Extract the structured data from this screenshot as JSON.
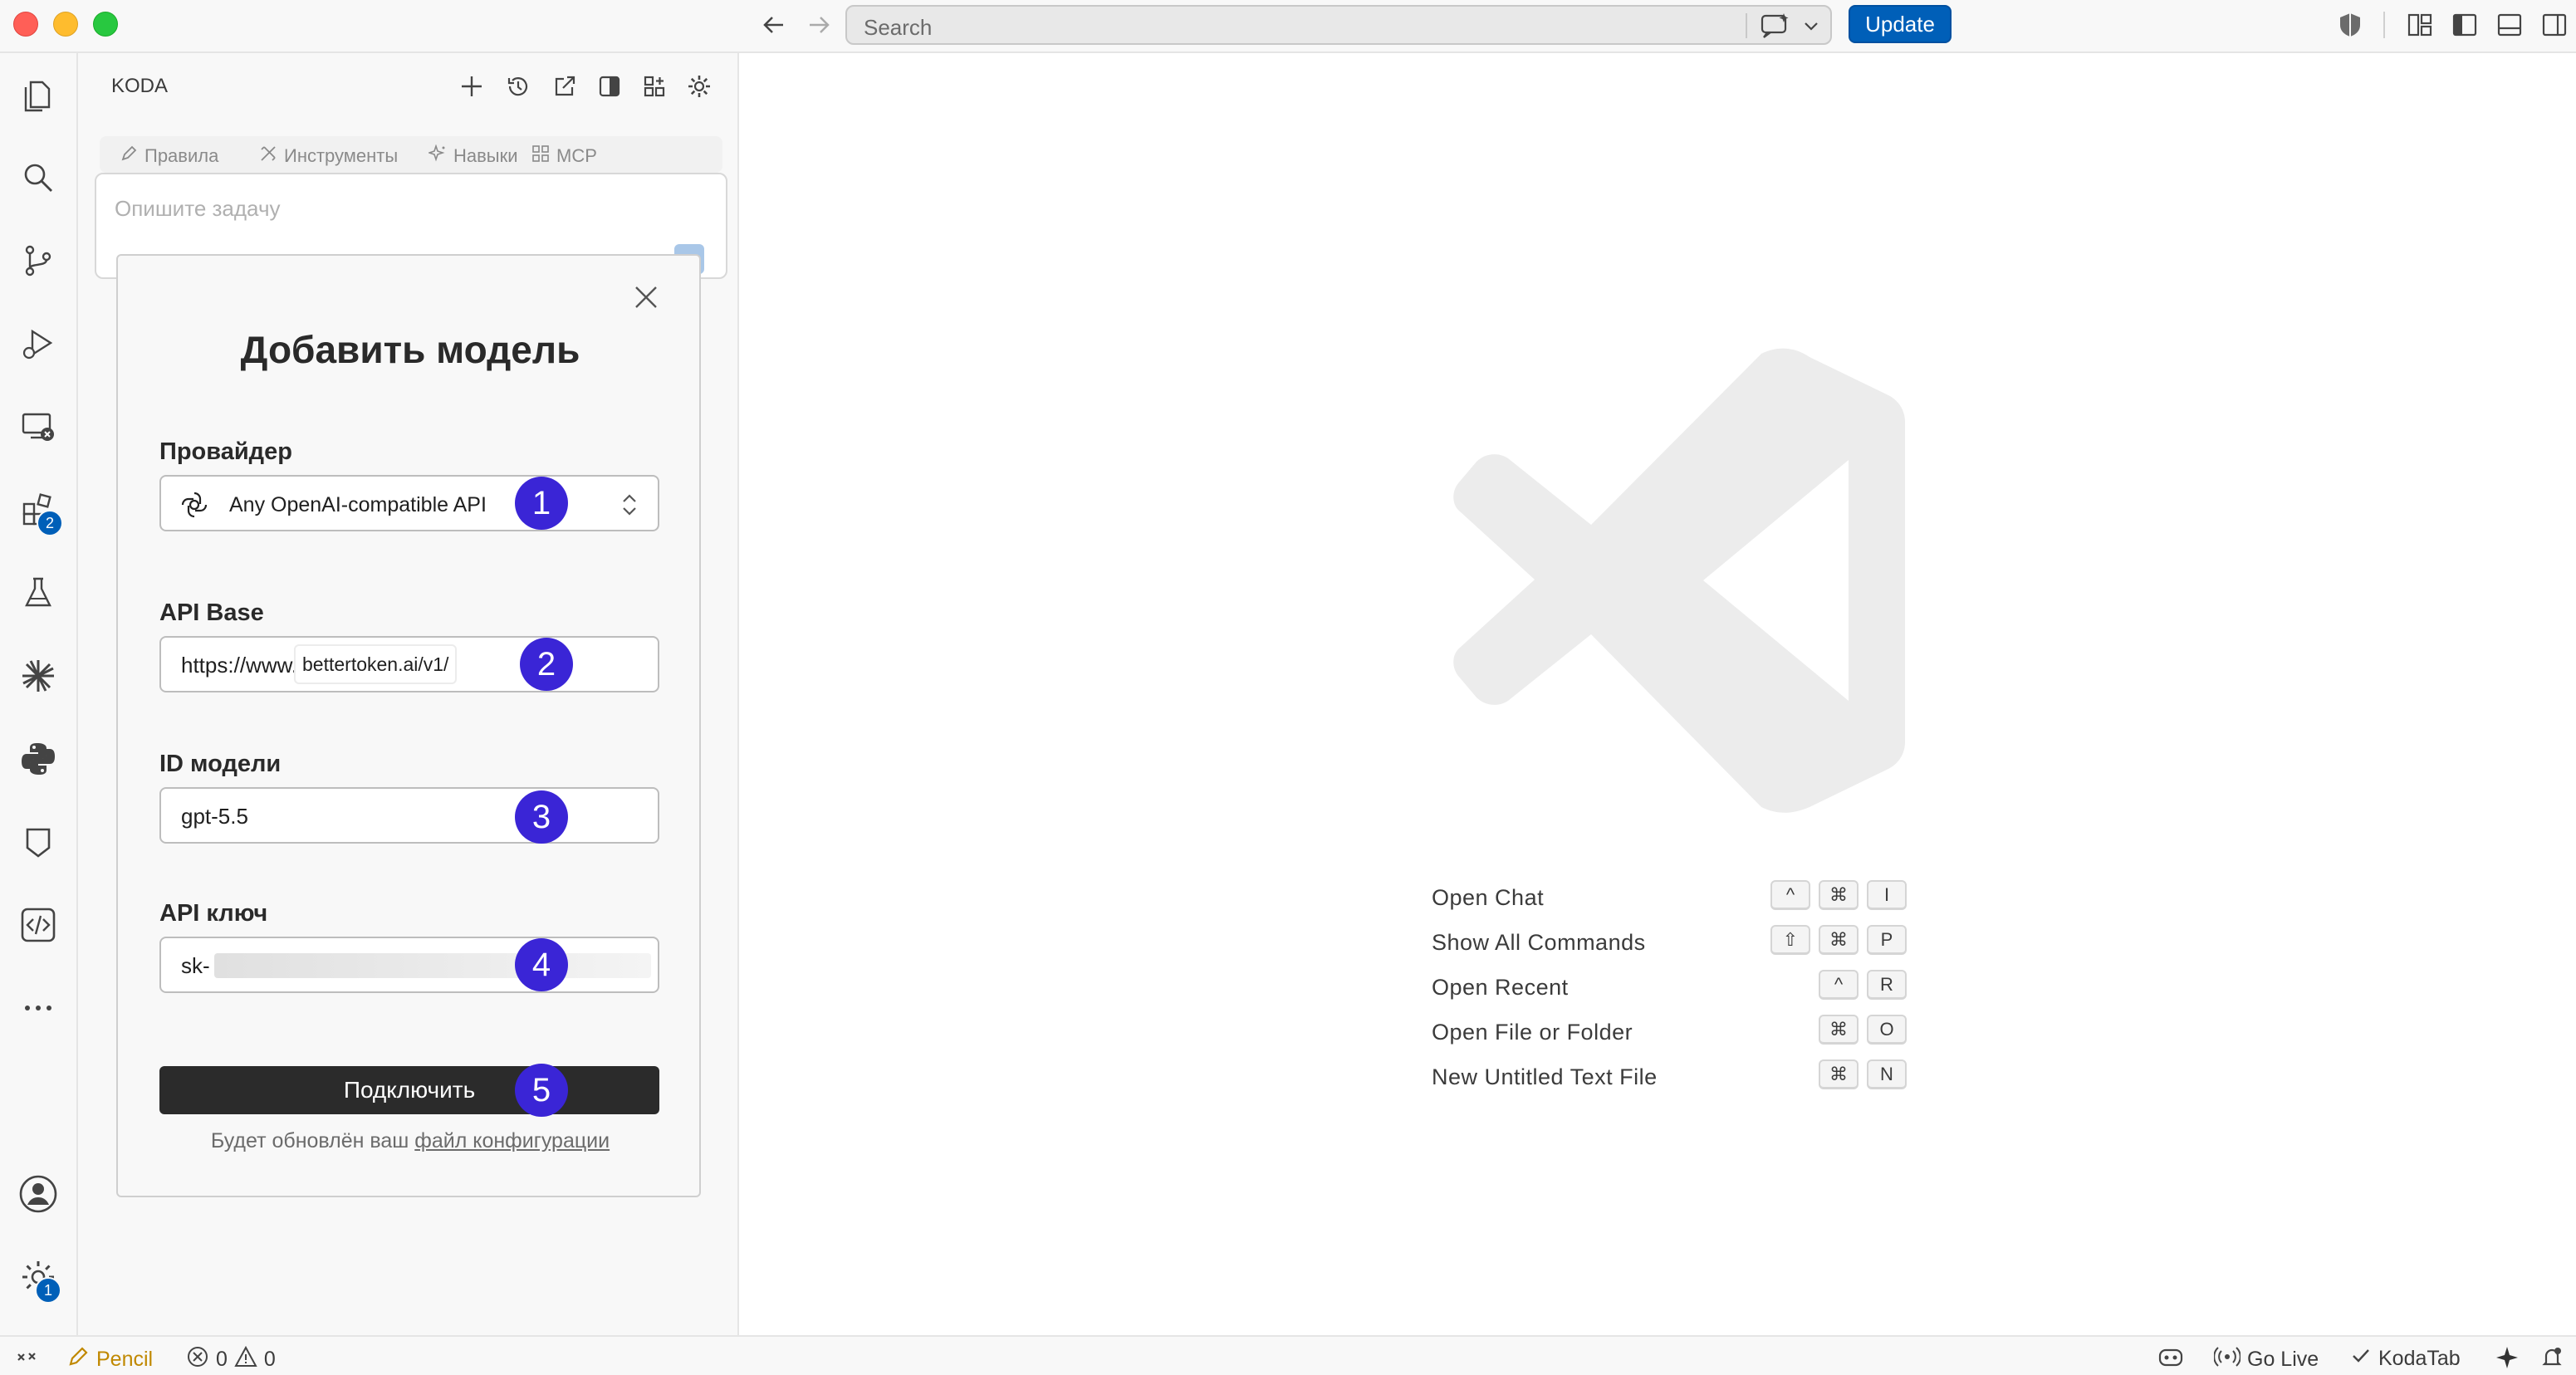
{
  "titlebar": {
    "search_placeholder": "Search",
    "update_label": "Update"
  },
  "activity": {
    "extensions_badge": "2",
    "settings_badge": "1"
  },
  "panel": {
    "title": "KODA",
    "rules": [
      "Правила",
      "Инструменты",
      "Навыки",
      "MCP"
    ],
    "task_placeholder": "Опишите задачу"
  },
  "modal": {
    "title": "Добавить модель",
    "provider_label": "Провайдер",
    "provider_value": "Any OpenAI-compatible API",
    "api_base_label": "API Base",
    "api_base_prefix": "https://www.",
    "api_base_rest": "bettertoken.ai/v1/",
    "model_id_label": "ID модели",
    "model_id_value": "gpt-5.5",
    "api_key_label": "API ключ",
    "api_key_value": "sk-",
    "connect_label": "Подключить",
    "note_prefix": "Будет обновлён ваш",
    "note_link": "файл конфигурации",
    "steps": [
      "1",
      "2",
      "3",
      "4",
      "5"
    ]
  },
  "shortcuts": [
    {
      "label": "Open Chat",
      "keys": [
        "^",
        "⌘",
        "I"
      ]
    },
    {
      "label": "Show All Commands",
      "keys": [
        "⇧",
        "⌘",
        "P"
      ]
    },
    {
      "label": "Open Recent",
      "keys": [
        "^",
        "R"
      ]
    },
    {
      "label": "Open File or Folder",
      "keys": [
        "⌘",
        "O"
      ]
    },
    {
      "label": "New Untitled Text File",
      "keys": [
        "⌘",
        "N"
      ]
    }
  ],
  "statusbar": {
    "pencil": "Pencil",
    "errors": "0",
    "warnings": "0",
    "go_live": "Go Live",
    "kodatab": "KodaTab"
  },
  "colors": {
    "accent": "#005fb8",
    "step": "#3a25d6",
    "button_dark": "#2b2b2b"
  }
}
